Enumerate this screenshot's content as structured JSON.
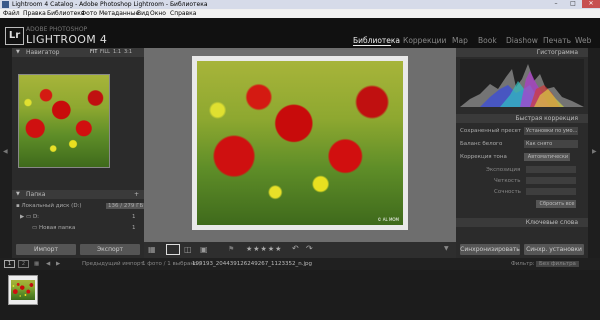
{
  "window": {
    "title": "Lightroom 4 Catalog - Adobe Photoshop Lightroom - Библиотека",
    "minimize": "–",
    "maximize": "□",
    "close": "✕"
  },
  "menu": [
    "Файл",
    "Правка",
    "Библиотека",
    "Фото",
    "Метаданные",
    "Вид",
    "Окно",
    "Справка"
  ],
  "header": {
    "logo": "Lr",
    "subtitle": "ADOBE PHOTOSHOP",
    "product": "LIGHTROOM 4"
  },
  "modules": [
    {
      "label": "Библиотека"
    },
    {
      "label": "Коррекции"
    },
    {
      "label": "Map"
    },
    {
      "label": "Book"
    },
    {
      "label": "Diashow"
    },
    {
      "label": "Печать"
    },
    {
      "label": "Web"
    }
  ],
  "navigator": {
    "title": "Навигатор",
    "zoom": [
      "FIT",
      "FILL",
      "1:1",
      "3:1"
    ]
  },
  "folders": {
    "title": "Папка",
    "disk_label": "Локальный диск (D:)",
    "disk_size": "136 / 279 ГБ",
    "items": [
      {
        "label": "D:",
        "count": "1"
      },
      {
        "label": "Новая папка",
        "count": "1"
      }
    ]
  },
  "left_buttons": {
    "import": "Импорт",
    "export": "Экспорт"
  },
  "right": {
    "histogram": "Гистограмма",
    "quick_dev": "Быстрая коррекция",
    "saved_preset_label": "Сохраненный пресет",
    "saved_preset_value": "Установки по умо...",
    "wb_label": "Баланс белого",
    "wb_value": "Как снято",
    "tone_label": "Коррекция тона",
    "tone_value": "Автоматически",
    "exposure": "Экспозиция",
    "clarity": "Четкость",
    "vibrance": "Сочность",
    "reset_all": "Сбросить все",
    "keywords": "Ключевые слова",
    "sync": "Синхронизировать",
    "sync_settings": "Синхр. установки"
  },
  "toolbar": {
    "stars": "★★★★★"
  },
  "filmstrip": {
    "page1": "1",
    "page2": "2",
    "source": "Предыдущий импорт",
    "info": "1 фото / 1 выбрано /",
    "filename": "199193_204439126249267_1123352_n.jpg",
    "filter_label": "Фильтр:",
    "filter_value": "Без фильтра"
  },
  "watermark": "© AL MOM"
}
